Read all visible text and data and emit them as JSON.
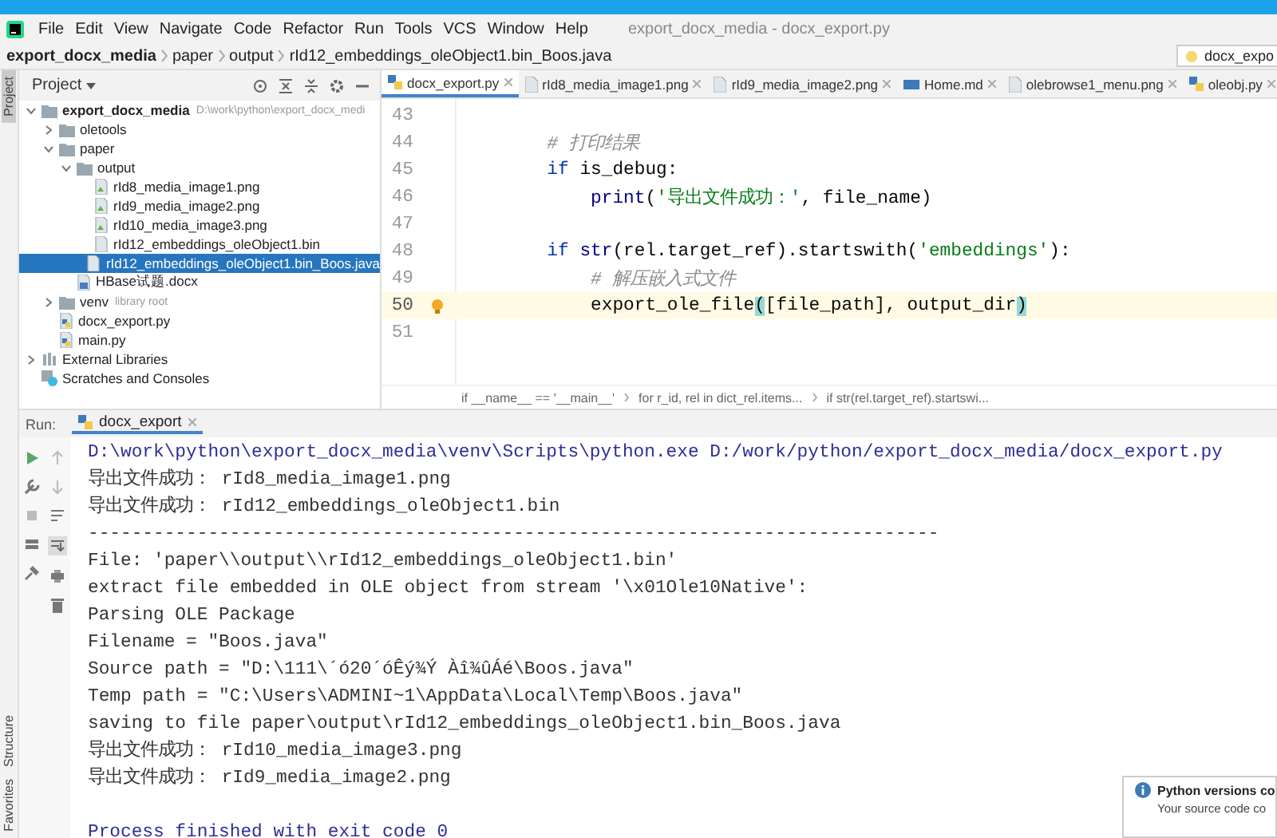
{
  "menu": [
    "File",
    "Edit",
    "View",
    "Navigate",
    "Code",
    "Refactor",
    "Run",
    "Tools",
    "VCS",
    "Window",
    "Help"
  ],
  "window": {
    "title": "export_docx_media - docx_export.py"
  },
  "breadcrumb": [
    "export_docx_media",
    "paper",
    "output",
    "rId12_embeddings_oleObject1.bin_Boos.java"
  ],
  "run_config": "docx_expo",
  "side_stripe": {
    "top": [
      {
        "label": "Project",
        "selected": true
      }
    ],
    "bottom": [
      {
        "label": "Structure",
        "selected": false
      },
      {
        "label": "Favorites",
        "selected": false
      }
    ]
  },
  "project": {
    "title": "Project",
    "tree": [
      {
        "label": "export_docx_media",
        "hint": "D:\\work\\python\\export_docx_medi",
        "kind": "folder",
        "expanded": true,
        "selected": false,
        "children": [
          {
            "label": "oletools",
            "kind": "folder",
            "expanded": false,
            "selected": false
          },
          {
            "label": "paper",
            "kind": "folder",
            "expanded": true,
            "selected": false,
            "children": [
              {
                "label": "output",
                "kind": "folder",
                "expanded": true,
                "selected": false,
                "children": [
                  {
                    "label": "rId8_media_image1.png",
                    "kind": "image",
                    "selected": false
                  },
                  {
                    "label": "rId9_media_image2.png",
                    "kind": "image",
                    "selected": false
                  },
                  {
                    "label": "rId10_media_image3.png",
                    "kind": "image",
                    "selected": false
                  },
                  {
                    "label": "rId12_embeddings_oleObject1.bin",
                    "kind": "file",
                    "selected": false
                  },
                  {
                    "label": "rId12_embeddings_oleObject1.bin_Boos.java",
                    "kind": "file",
                    "selected": true
                  }
                ]
              },
              {
                "label": "HBase试题.docx",
                "kind": "doc",
                "selected": false
              }
            ]
          },
          {
            "label": "venv",
            "hint": "library root",
            "kind": "folder",
            "expanded": false,
            "selected": false
          },
          {
            "label": "docx_export.py",
            "kind": "python",
            "selected": false
          },
          {
            "label": "main.py",
            "kind": "python",
            "selected": false
          }
        ]
      },
      {
        "label": "External Libraries",
        "kind": "library",
        "expanded": false,
        "selected": false
      },
      {
        "label": "Scratches and Consoles",
        "kind": "scratch",
        "selected": false
      }
    ]
  },
  "tabs": [
    {
      "label": "docx_export.py",
      "kind": "python",
      "selected": true
    },
    {
      "label": "rId8_media_image1.png",
      "kind": "image",
      "selected": false
    },
    {
      "label": "rId9_media_image2.png",
      "kind": "image",
      "selected": false
    },
    {
      "label": "Home.md",
      "kind": "markdown",
      "selected": false
    },
    {
      "label": "olebrowse1_menu.png",
      "kind": "image",
      "selected": false
    },
    {
      "label": "oleobj.py",
      "kind": "python",
      "selected": false
    }
  ],
  "code": [
    {
      "number": "43",
      "current": false
    },
    {
      "number": "44",
      "current": false,
      "tokens": [
        {
          "text": "        # 打印结果",
          "kind": "comment"
        }
      ]
    },
    {
      "number": "45",
      "current": false,
      "tokens": [
        {
          "text": "        if",
          "kind": "keyword"
        },
        {
          "text": " is_debug:",
          "kind": "plain"
        }
      ]
    },
    {
      "number": "46",
      "current": false,
      "tokens": [
        {
          "text": "            print",
          "kind": "builtin"
        },
        {
          "text": "(",
          "kind": "plain"
        },
        {
          "text": "'导出文件成功：'",
          "kind": "string"
        },
        {
          "text": ", file_name)",
          "kind": "plain"
        }
      ]
    },
    {
      "number": "47",
      "current": false
    },
    {
      "number": "48",
      "current": false,
      "tokens": [
        {
          "text": "        if",
          "kind": "keyword"
        },
        {
          "text": " str",
          "kind": "builtin"
        },
        {
          "text": "(rel.target_ref).startswith(",
          "kind": "plain"
        },
        {
          "text": "'embeddings'",
          "kind": "string"
        },
        {
          "text": "):",
          "kind": "plain"
        }
      ]
    },
    {
      "number": "49",
      "current": false,
      "tokens": [
        {
          "text": "            # 解压嵌入式文件",
          "kind": "comment"
        }
      ]
    },
    {
      "number": "50",
      "current": true,
      "tokens": [
        {
          "text": "            export_ole_file",
          "kind": "plain"
        },
        {
          "text": "(",
          "kind": "match"
        },
        {
          "text": "[file_path], output_dir",
          "kind": "plain"
        },
        {
          "text": ")",
          "kind": "match"
        }
      ]
    },
    {
      "number": "51",
      "current": false
    }
  ],
  "editor_breadcrumb": [
    "if __name__ == '__main__'",
    "for r_id, rel in dict_rel.items...",
    "if str(rel.target_ref).startswi..."
  ],
  "run": {
    "label": "Run:",
    "tab": "docx_export",
    "lines": [
      {
        "text": "D:\\work\\python\\export_docx_media\\venv\\Scripts\\python.exe D:/work/python/export_docx_media/docx_export.py",
        "kind": "command"
      },
      {
        "text": "导出文件成功： rId8_media_image1.png",
        "kind": "output"
      },
      {
        "text": "导出文件成功： rId12_embeddings_oleObject1.bin",
        "kind": "output"
      },
      {
        "text": "------------------------------------------------------------------------------",
        "kind": "output"
      },
      {
        "text": "File: 'paper\\\\output\\\\rId12_embeddings_oleObject1.bin'",
        "kind": "output"
      },
      {
        "text": "extract file embedded in OLE object from stream '\\x01Ole10Native':",
        "kind": "output"
      },
      {
        "text": "Parsing OLE Package",
        "kind": "output"
      },
      {
        "text": "Filename = \"Boos.java\"",
        "kind": "output"
      },
      {
        "text": "Source path = \"D:\\111\\´ó20´óÊý¾Ý Àî¾ûÁé\\Boos.java\"",
        "kind": "output"
      },
      {
        "text": "Temp path = \"C:\\Users\\ADMINI~1\\AppData\\Local\\Temp\\Boos.java\"",
        "kind": "output"
      },
      {
        "text": "saving to file paper\\output\\rId12_embeddings_oleObject1.bin_Boos.java",
        "kind": "output"
      },
      {
        "text": "导出文件成功： rId10_media_image3.png",
        "kind": "output"
      },
      {
        "text": "导出文件成功： rId9_media_image2.png",
        "kind": "output"
      },
      {
        "text": "Process finished with exit code 0",
        "kind": "exit"
      }
    ]
  },
  "notification": {
    "title": "Python versions co",
    "body": "Your source code co"
  }
}
